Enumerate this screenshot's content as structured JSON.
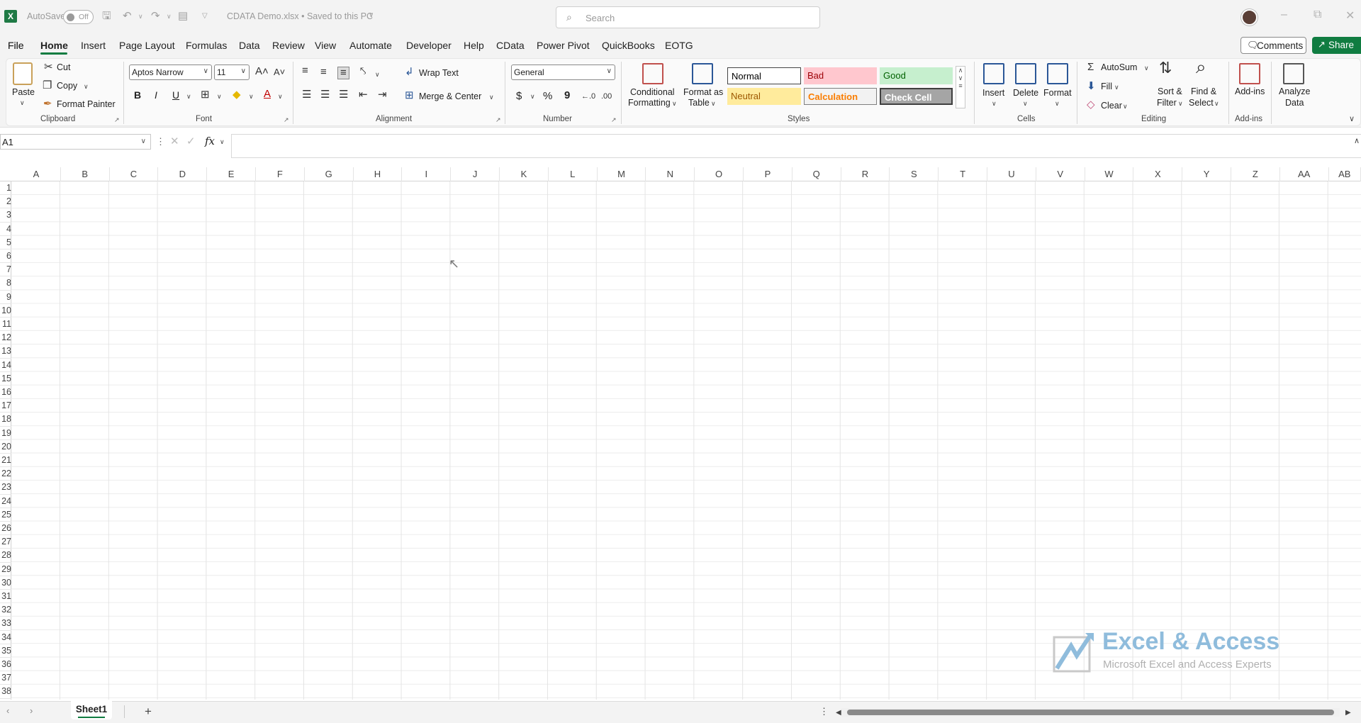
{
  "titlebar": {
    "app_icon": "excel-logo",
    "logo_letter": "X",
    "autosave_label": "AutoSave",
    "autosave_state": "Off",
    "doc_title": "CDATA Demo.xlsx • Saved to this PC",
    "search_placeholder": "Search"
  },
  "menu": {
    "tabs": [
      "File",
      "Home",
      "Insert",
      "Page Layout",
      "Formulas",
      "Data",
      "Review",
      "View",
      "Automate",
      "Developer",
      "Help",
      "CData",
      "Power Pivot",
      "QuickBooks",
      "EOTG"
    ],
    "active": "Home",
    "comments_label": "Comments",
    "share_label": "Share"
  },
  "ribbon": {
    "clipboard": {
      "label": "Clipboard",
      "paste": "Paste",
      "cut": "Cut",
      "copy": "Copy",
      "format_painter": "Format Painter"
    },
    "font": {
      "label": "Font",
      "font_name": "Aptos Narrow",
      "font_size": "11",
      "bold": "B",
      "italic": "I",
      "underline": "U"
    },
    "alignment": {
      "label": "Alignment",
      "wrap_text": "Wrap Text",
      "merge_center": "Merge & Center"
    },
    "number": {
      "label": "Number",
      "format": "General",
      "currency": "$",
      "percent": "%",
      "comma": "9"
    },
    "styles": {
      "label": "Styles",
      "conditional_1": "Conditional",
      "conditional_2": "Formatting",
      "format_table_1": "Format as",
      "format_table_2": "Table",
      "cells": [
        {
          "name": "Normal",
          "bg": "#ffffff",
          "fg": "#000000"
        },
        {
          "name": "Bad",
          "bg": "#ffc7ce",
          "fg": "#9c0006"
        },
        {
          "name": "Good",
          "bg": "#c6efce",
          "fg": "#006100"
        },
        {
          "name": "Neutral",
          "bg": "#ffeb9c",
          "fg": "#9c5700"
        },
        {
          "name": "Calculation",
          "bg": "#f2f2f2",
          "fg": "#fa7d00"
        },
        {
          "name": "Check Cell",
          "bg": "#a5a5a5",
          "fg": "#ffffff"
        }
      ]
    },
    "cells": {
      "label": "Cells",
      "insert": "Insert",
      "delete": "Delete",
      "format": "Format"
    },
    "editing": {
      "label": "Editing",
      "autosum": "AutoSum",
      "fill": "Fill",
      "clear": "Clear",
      "sort_1": "Sort &",
      "sort_2": "Filter",
      "find_1": "Find &",
      "find_2": "Select"
    },
    "addins": {
      "label": "Add-ins",
      "addins": "Add-ins",
      "analyze_1": "Analyze",
      "analyze_2": "Data"
    }
  },
  "formula_bar": {
    "name_box": "A1",
    "fx": "fx",
    "value": ""
  },
  "grid": {
    "columns": [
      "A",
      "B",
      "C",
      "D",
      "E",
      "F",
      "G",
      "H",
      "I",
      "J",
      "K",
      "L",
      "M",
      "N",
      "O",
      "P",
      "Q",
      "R",
      "S",
      "T",
      "U",
      "V",
      "W",
      "X",
      "Y",
      "Z",
      "AA",
      "AB"
    ],
    "rows": [
      "1",
      "2",
      "3",
      "4",
      "5",
      "6",
      "7",
      "8",
      "9",
      "10",
      "11",
      "12",
      "13",
      "14",
      "15",
      "16",
      "17",
      "18",
      "19",
      "20",
      "21",
      "22",
      "23",
      "24",
      "25",
      "26",
      "27",
      "28",
      "29",
      "30",
      "31",
      "32",
      "33",
      "34",
      "35",
      "36",
      "37",
      "38"
    ]
  },
  "watermark": {
    "title": "Excel & Access",
    "subtitle": "Microsoft Excel and Access Experts"
  },
  "sheets": {
    "tabs": [
      "Sheet1"
    ],
    "active": "Sheet1",
    "add_label": "+"
  }
}
